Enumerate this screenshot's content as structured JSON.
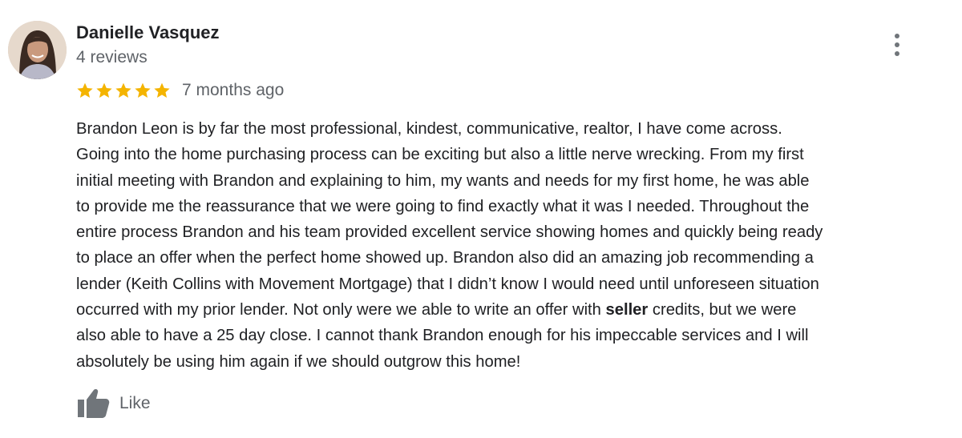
{
  "reviewer": {
    "name": "Danielle Vasquez",
    "review_count": "4 reviews"
  },
  "rating": {
    "stars": 5,
    "max_stars": 5,
    "star_icon": "star-icon",
    "star_color": "#f4b400"
  },
  "review": {
    "date": "7 months ago",
    "lines": [
      "Brandon Leon is by far the most professional, kindest, communicative, realtor, I have come across.",
      "Going into the home purchasing process can be exciting but also a little nerve wrecking. From my first",
      "initial meeting with Brandon and explaining to him, my wants and needs for my first home, he was able",
      "to provide me the reassurance that we were going to find exactly what it was I needed. Throughout the",
      "entire process Brandon and his team provided excellent service showing homes and quickly being ready",
      "to place an offer when the perfect home showed up. Brandon also did an amazing job recommending a",
      "lender (Keith Collins with Movement Mortgage) that I didn’t know I would need until unforeseen situation",
      "occurred with my prior lender. Not only were we able to write an offer with ",
      "seller",
      " credits, but we were",
      "also able to have a 25 day close. I cannot thank  Brandon enough for his impeccable services and I will",
      "absolutely be using him again if we should outgrow this home!"
    ]
  },
  "actions": {
    "like_label": "Like",
    "like_icon": "thumbs-up-icon",
    "more_icon": "more-vert-icon"
  },
  "colors": {
    "text_primary": "#202124",
    "text_secondary": "#5f6368",
    "icon_gray": "#70757a"
  }
}
